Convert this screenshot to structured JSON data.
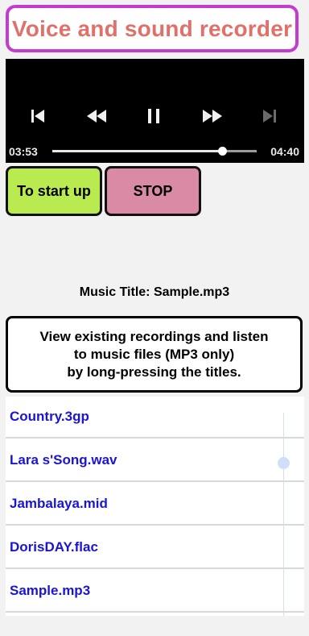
{
  "app": {
    "title": "Voice and sound recorder"
  },
  "player": {
    "current_time": "03:53",
    "total_time": "04:40",
    "progress_fraction": 0.832,
    "controls": [
      "skip-previous-icon",
      "rewind-icon",
      "pause-icon",
      "fast-forward-icon",
      "skip-next-icon"
    ]
  },
  "buttons": {
    "start_label": "To start up",
    "stop_label": "STOP",
    "start_color": "#b9ea4f",
    "stop_color": "#d98aa5"
  },
  "music_title": "Music Title: Sample.mp3",
  "info": {
    "line1": "View existing recordings and listen",
    "line2": "to music files (MP3 only)",
    "line3": "by long-pressing the titles."
  },
  "files": [
    {
      "name": "Country.3gp"
    },
    {
      "name": "Lara s'Song.wav"
    },
    {
      "name": "Jambalaya.mid"
    },
    {
      "name": "DorisDAY.flac"
    },
    {
      "name": "Sample.mp3"
    }
  ]
}
